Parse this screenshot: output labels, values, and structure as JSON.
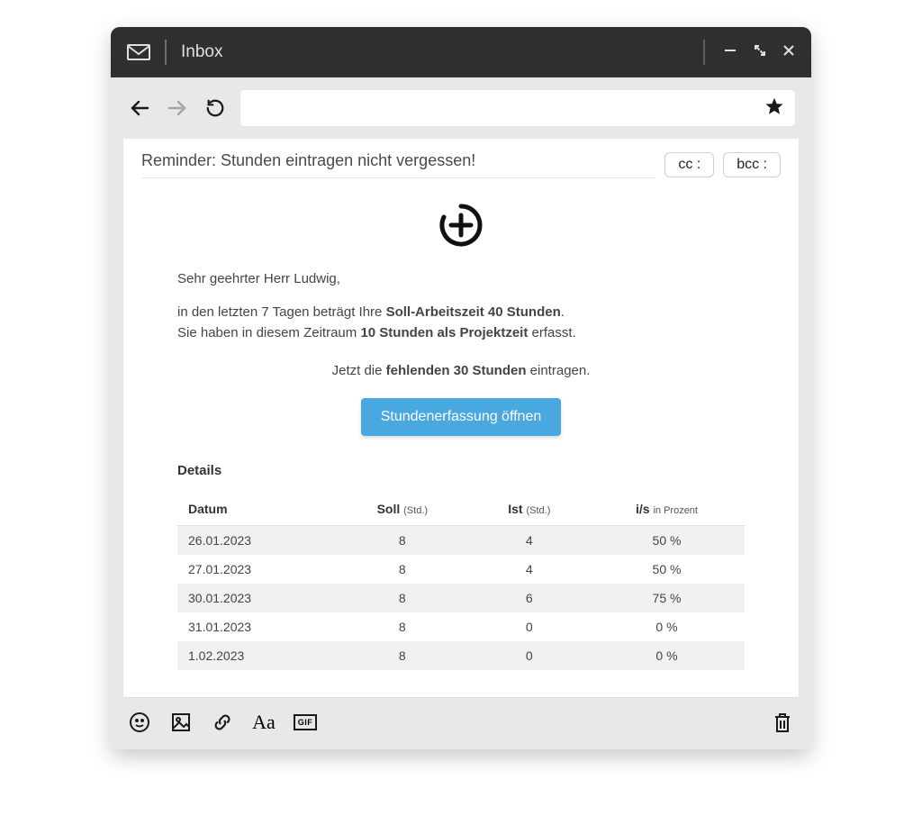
{
  "titlebar": {
    "title": "Inbox"
  },
  "subject": "Reminder: Stunden eintragen nicht vergessen!",
  "cc_label": "cc :",
  "bcc_label": "bcc :",
  "body": {
    "greeting": "Sehr geehrter Herr Ludwig,",
    "line1_a": "in den letzten 7 Tagen beträgt Ihre ",
    "line1_b": "Soll-Arbeitszeit 40 Stunden",
    "line1_c": ".",
    "line2_a": "Sie haben in diesem Zeitraum ",
    "line2_b": "10 Stunden als Projektzeit",
    "line2_c": " erfasst.",
    "cta_line_a": "Jetzt die ",
    "cta_line_b": "fehlenden 30 Stunden",
    "cta_line_c": " eintragen.",
    "cta_button": "Stundenerfassung öffnen",
    "details_heading": "Details"
  },
  "table": {
    "headers": {
      "date": "Datum",
      "soll": "Soll",
      "soll_sub": "(Std.)",
      "ist": "Ist",
      "ist_sub": "(Std.)",
      "pct": "i/s",
      "pct_sub": "in Prozent"
    },
    "rows": [
      {
        "date": "26.01.2023",
        "soll": "8",
        "ist": "4",
        "pct": "50 %"
      },
      {
        "date": "27.01.2023",
        "soll": "8",
        "ist": "4",
        "pct": "50 %"
      },
      {
        "date": "30.01.2023",
        "soll": "8",
        "ist": "6",
        "pct": "75 %"
      },
      {
        "date": "31.01.2023",
        "soll": "8",
        "ist": "0",
        "pct": "0 %"
      },
      {
        "date": "1.02.2023",
        "soll": "8",
        "ist": "0",
        "pct": "0 %"
      }
    ]
  },
  "footer": {
    "gif_label": "GIF"
  }
}
